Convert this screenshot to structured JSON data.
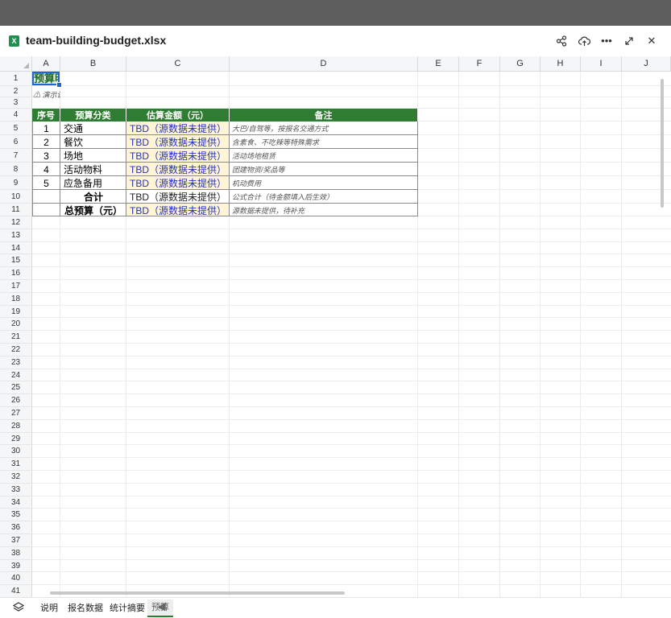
{
  "window": {
    "file_name": "team-building-budget.xlsx",
    "file_icon_letter": "X",
    "actions": [
      "share-icon",
      "upload-icon",
      "more-icon",
      "expand-icon",
      "close-icon"
    ]
  },
  "colors": {
    "header_green": "#2e7d32",
    "tbd_fill": "#fff4d6",
    "tbd_text": "#2433b8",
    "selection_blue": "#1f66d1"
  },
  "columns": [
    "A",
    "B",
    "C",
    "D",
    "E",
    "F",
    "G",
    "H",
    "I",
    "J"
  ],
  "rows": [
    "1",
    "2",
    "3",
    "4",
    "5",
    "6",
    "7",
    "8",
    "9",
    "10",
    "11",
    "12",
    "13",
    "14",
    "15",
    "16",
    "17",
    "18",
    "19",
    "20",
    "21",
    "22",
    "23",
    "24",
    "25",
    "26",
    "27",
    "28",
    "29",
    "30",
    "31",
    "32",
    "33",
    "34",
    "35",
    "36",
    "37",
    "38",
    "39",
    "40",
    "41"
  ],
  "cells": {
    "a1": "预算明细",
    "a2": "⚠ 演示说明"
  },
  "table": {
    "headers": [
      "序号",
      "预算分类",
      "估算金额（元）",
      "备注"
    ],
    "rows": [
      {
        "no": "1",
        "category": "交通",
        "amount": "TBD（源数据未提供）",
        "note": "大巴/自驾等，按报名交通方式"
      },
      {
        "no": "2",
        "category": "餐饮",
        "amount": "TBD（源数据未提供）",
        "note": "含素食、不吃辣等特殊需求"
      },
      {
        "no": "3",
        "category": "场地",
        "amount": "TBD（源数据未提供）",
        "note": "活动场地租赁"
      },
      {
        "no": "4",
        "category": "活动物料",
        "amount": "TBD（源数据未提供）",
        "note": "团建物资/奖品等"
      },
      {
        "no": "5",
        "category": "应急备用",
        "amount": "TBD（源数据未提供）",
        "note": "机动费用"
      }
    ],
    "subtotal": {
      "label": "合计",
      "amount": "TBD（源数据未提供）",
      "note": "公式合计（待金额填入后生效）"
    },
    "total": {
      "label": "总预算（元）",
      "amount": "TBD（源数据未提供）",
      "note": "源数据未提供，待补充"
    }
  },
  "sheet_tabs": [
    "说明",
    "报名数据",
    "统计摘要",
    "预算"
  ]
}
